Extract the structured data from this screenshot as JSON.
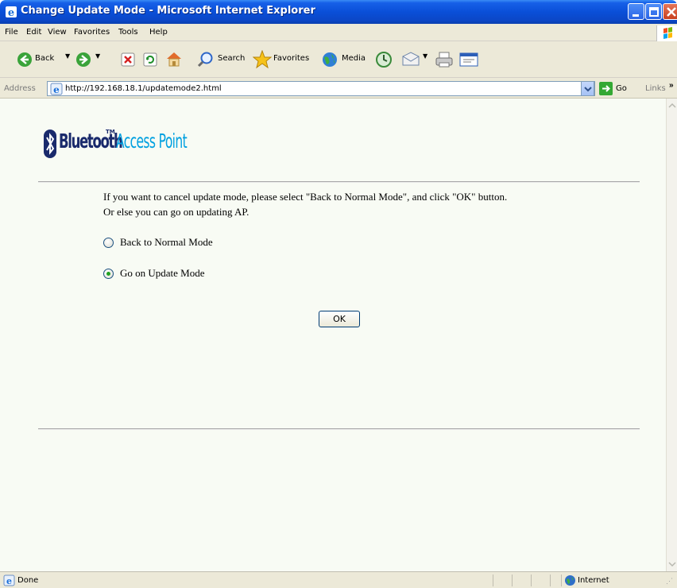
{
  "window": {
    "title": "Change Update Mode - Microsoft Internet Explorer"
  },
  "menu": {
    "items": [
      "File",
      "Edit",
      "View",
      "Favorites",
      "Tools",
      "Help"
    ]
  },
  "toolbar": {
    "back_label": "Back",
    "search_label": "Search",
    "favorites_label": "Favorites",
    "media_label": "Media"
  },
  "addressbar": {
    "label": "Address",
    "url": "http://192.168.18.1/updatemode2.html",
    "go_label": "Go",
    "links_label": "Links"
  },
  "page": {
    "logo_brand": "Bluetooth",
    "logo_tm": "TM",
    "logo_product": "Access Point",
    "message_line1": "If you want to cancel update mode, please select \"Back to Normal Mode\", and click \"OK\" button.",
    "message_line2": "Or else you can go on updating AP.",
    "options": [
      {
        "label": "Back to Normal Mode",
        "selected": false
      },
      {
        "label": "Go on Update Mode",
        "selected": true
      }
    ],
    "ok_label": "OK"
  },
  "statusbar": {
    "status": "Done",
    "zone": "Internet"
  },
  "colors": {
    "title_blue": "#0a4fd8",
    "logo_dark": "#1a2a6c",
    "logo_cyan": "#00a0e0",
    "page_bg": "#f8fbf4"
  }
}
